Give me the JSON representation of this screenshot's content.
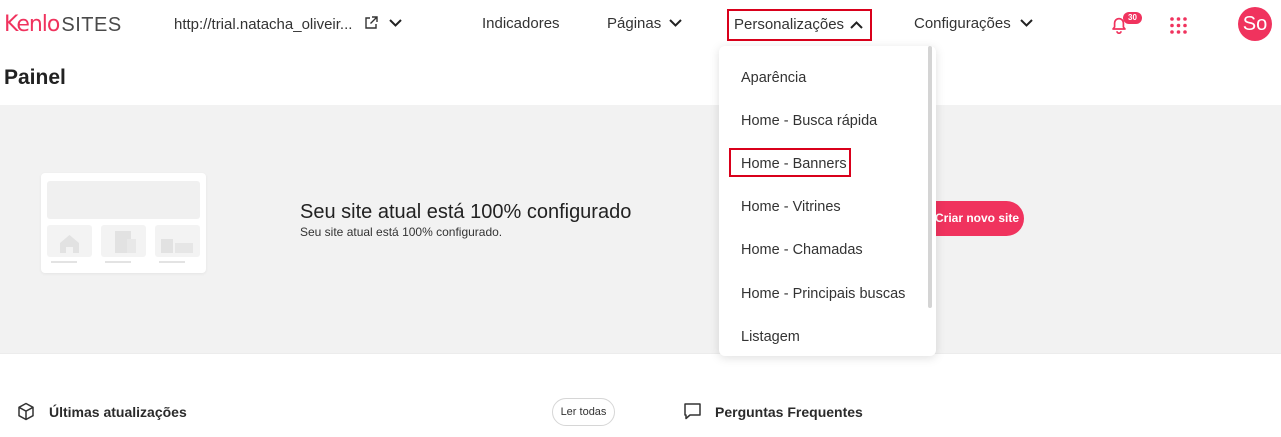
{
  "brand": {
    "logo_text": "Kenlo",
    "product": "SITES"
  },
  "header": {
    "site_url": "http://trial.natacha_oliveir...",
    "nav": {
      "indicadores": "Indicadores",
      "paginas": "Páginas",
      "personalizacoes": "Personalizações",
      "configuracoes": "Configurações"
    },
    "notifications_count": "30",
    "avatar_initials": "So"
  },
  "page_title": "Painel",
  "hero": {
    "title": "Seu site atual está 100% configurado",
    "subtitle": "Seu site atual está 100% configurado.",
    "cta_label": "Criar novo site"
  },
  "dropdown": {
    "items": [
      "Aparência",
      "Home - Busca rápida",
      "Home - Banners",
      "Home - Vitrines",
      "Home - Chamadas",
      "Home - Principais buscas",
      "Listagem"
    ]
  },
  "bottom": {
    "updates_title": "Últimas atualizações",
    "read_all_label": "Ler todas",
    "faq_title": "Perguntas Frequentes"
  },
  "colors": {
    "accent": "#f0335e",
    "highlight_border": "#d9001b",
    "hero_bg": "#f2f2f2"
  },
  "icons": [
    "external-link-icon",
    "chevron-down-icon",
    "chevron-up-icon",
    "bell-icon",
    "apps-grid-icon",
    "cube-icon",
    "chat-icon"
  ]
}
